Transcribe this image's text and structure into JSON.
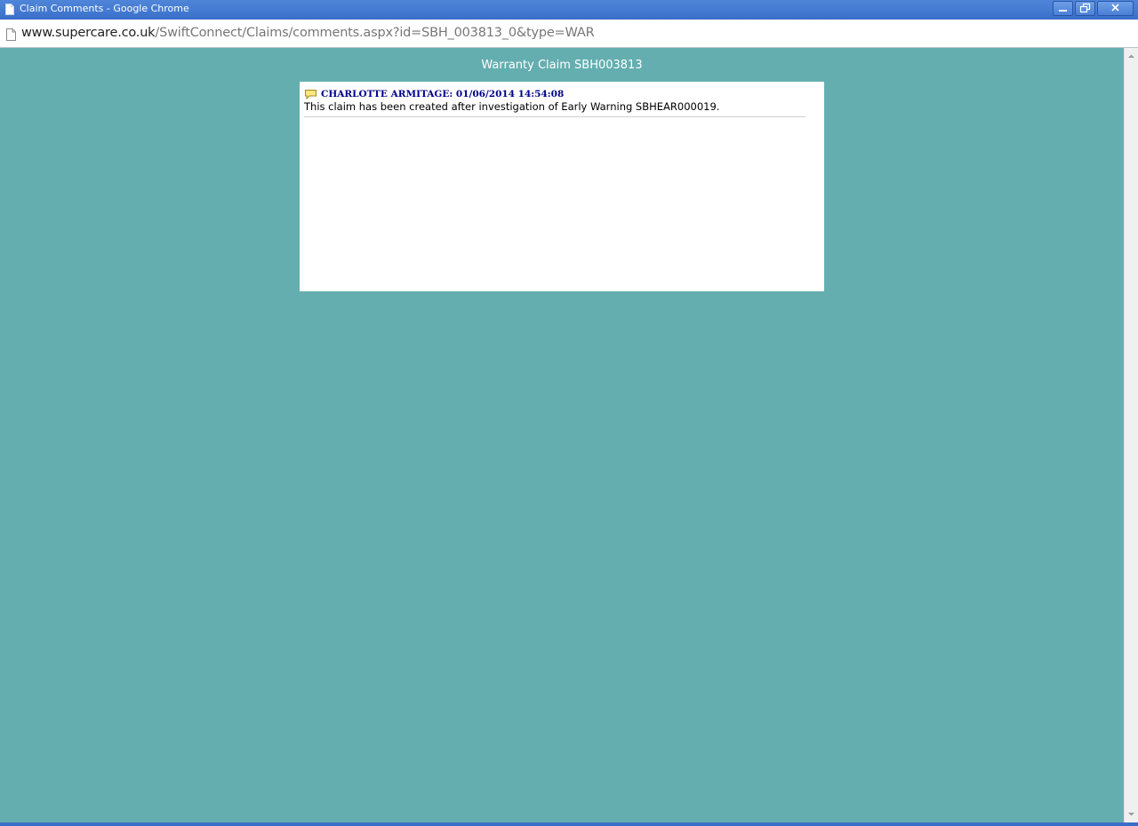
{
  "window": {
    "title": "Claim Comments - Google Chrome",
    "icons": {
      "page": "page-icon",
      "minimize": "minimize-icon",
      "restore": "restore-icon",
      "close": "close-icon"
    }
  },
  "address": {
    "host": "www.supercare.co.uk",
    "path": "/SwiftConnect/Claims/comments.aspx?id=SBH_003813_0&type=WAR"
  },
  "page": {
    "heading": "Warranty Claim SBH003813",
    "comments": [
      {
        "author": "CHARLOTTE ARMITAGE: 01/06/2014 14:54:08",
        "text": "This claim has been created after investigation of Early Warning SBHEAR000019.",
        "icon": "comment-bubble-icon"
      }
    ]
  },
  "colors": {
    "page_background": "#64aeb0",
    "titlebar": "#3a6fc9",
    "author_text": "#00008b"
  }
}
